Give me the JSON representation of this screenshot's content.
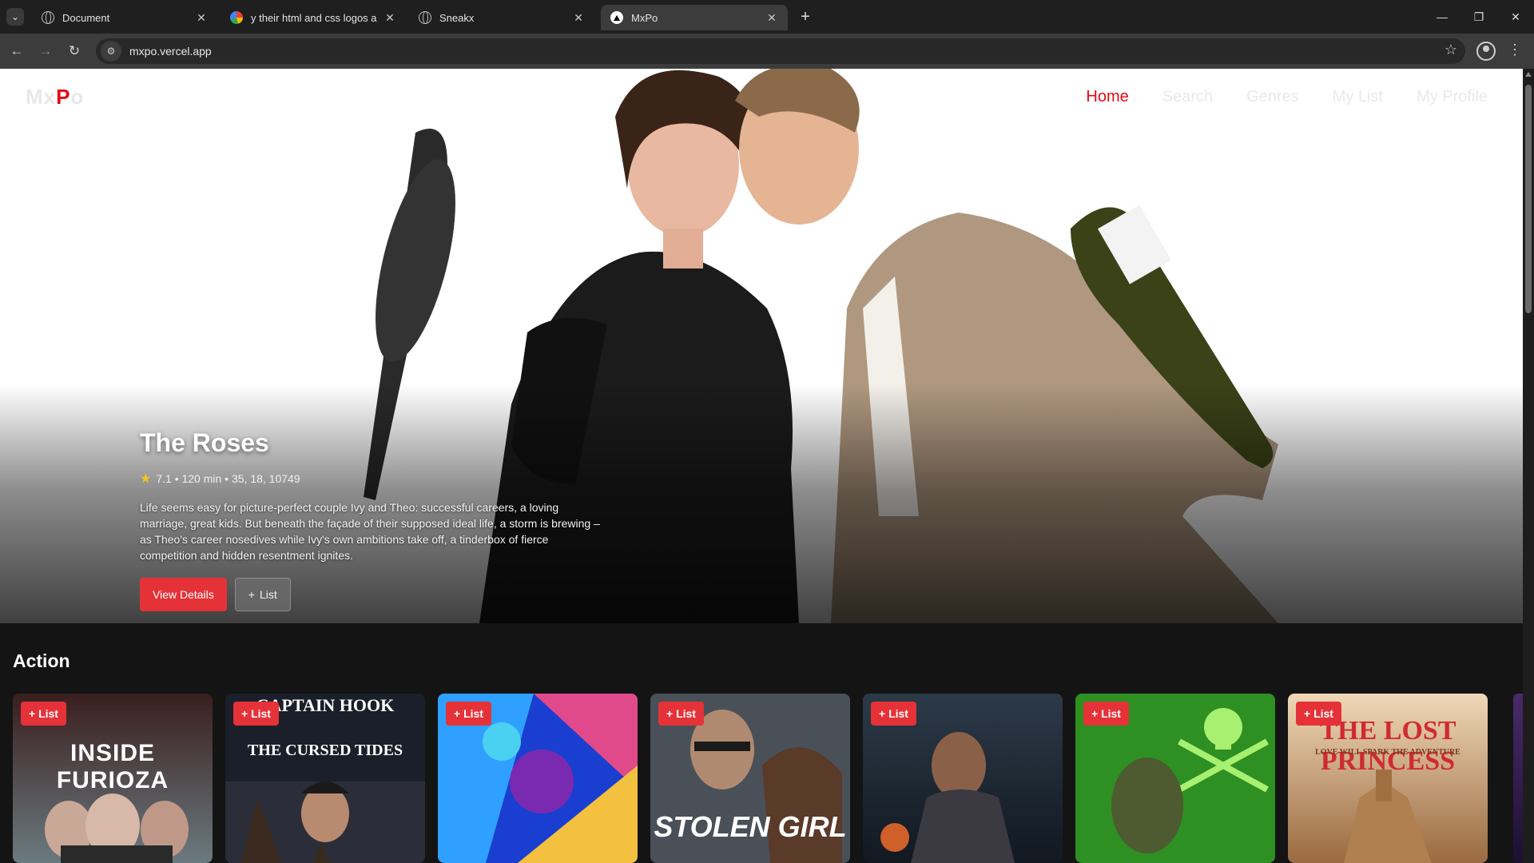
{
  "browser": {
    "tabs": [
      {
        "title": "Document",
        "icon": "globe-icon",
        "active": false
      },
      {
        "title": "y their html and css logos are li",
        "icon": "google-icon",
        "active": false
      },
      {
        "title": "Sneakx",
        "icon": "globe-icon",
        "active": false
      },
      {
        "title": "MxPo",
        "icon": "mxpo-icon",
        "active": true
      }
    ],
    "url": "mxpo.vercel.app"
  },
  "site": {
    "logo": {
      "part1": "Mx",
      "part2": "P",
      "part3": "o"
    },
    "nav": [
      {
        "label": "Home",
        "active": true
      },
      {
        "label": "Search",
        "active": false
      },
      {
        "label": "Genres",
        "active": false
      },
      {
        "label": "My List",
        "active": false
      },
      {
        "label": "My Profile",
        "active": false
      }
    ],
    "accent_color": "#e50914"
  },
  "hero": {
    "title": "The Roses",
    "meta": "7.1 • 120 min • 35, 18, 10749",
    "description": "Life seems easy for picture-perfect couple Ivy and Theo: successful careers, a loving marriage, great kids. But beneath the façade of their supposed ideal life, a storm is brewing – as Theo's career nosedives while Ivy's own ambitions take off, a tinderbox of fierce competition and hidden resentment ignites.",
    "primary_button": "View Details",
    "secondary_button": "List"
  },
  "rows": [
    {
      "title": "Action",
      "cards": [
        {
          "button": "+ List",
          "poster_title": "INSIDE FURIOZA"
        },
        {
          "button": "+ List",
          "poster_title": "CAPTAIN HOOK",
          "poster_subtitle": "THE CURSED TIDES"
        },
        {
          "button": "+ List",
          "poster_title": ""
        },
        {
          "button": "+ List",
          "poster_title": "STOLEN GIRL"
        },
        {
          "button": "+ List",
          "poster_title": ""
        },
        {
          "button": "+ List",
          "poster_title": ""
        },
        {
          "button": "+ List",
          "poster_title": "THE LOST PRINCESS",
          "poster_subtitle": "LOVE WILL SPARK THE ADVENTURE"
        }
      ]
    }
  ]
}
